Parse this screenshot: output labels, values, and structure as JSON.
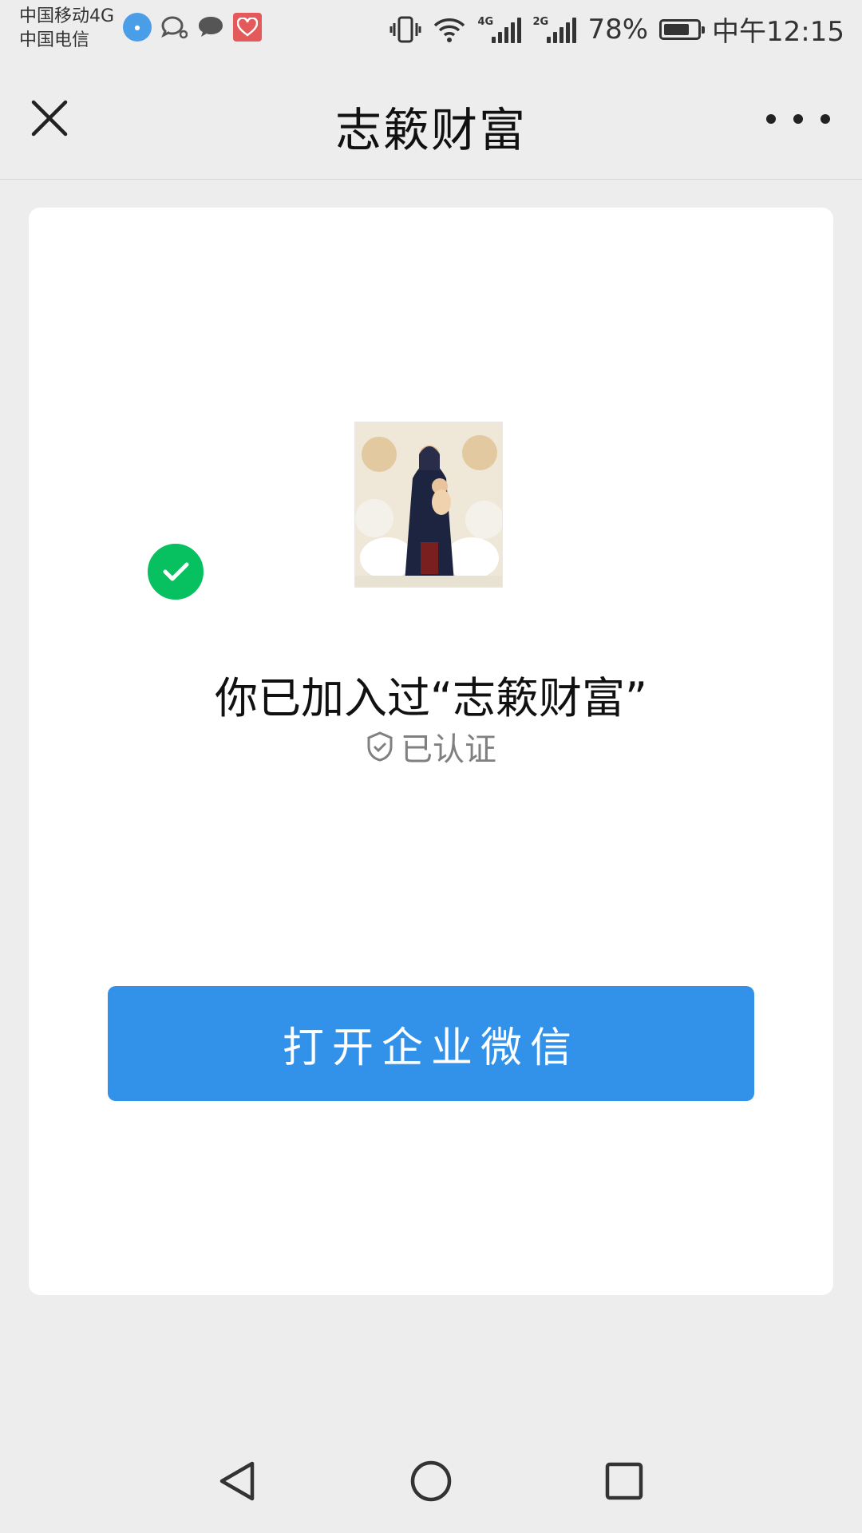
{
  "status_bar": {
    "carrier_1": "中国移动4G",
    "carrier_2": "中国电信",
    "signal_1_label": "4G",
    "signal_2_label": "2G",
    "battery_percent": "78%",
    "battery_level": 0.78,
    "time": "中午12:15",
    "notification_icons": [
      "weather-icon",
      "bubble-icon",
      "chat-icon",
      "heart-app-icon"
    ]
  },
  "title_bar": {
    "title": "志簌财富",
    "close_icon": "close-icon",
    "more_icon": "more-icon"
  },
  "card": {
    "joined_text": "你已加入过“志簌财富”",
    "verified_label": "已认证",
    "open_button_label": "打开企业微信"
  },
  "nav_bar": {
    "icons": [
      "back-icon",
      "home-icon",
      "recents-icon"
    ]
  },
  "colors": {
    "background": "#ededed",
    "card": "#ffffff",
    "accent_button": "#3291e8",
    "check_green": "#07c160",
    "verified_gray": "#808080"
  }
}
